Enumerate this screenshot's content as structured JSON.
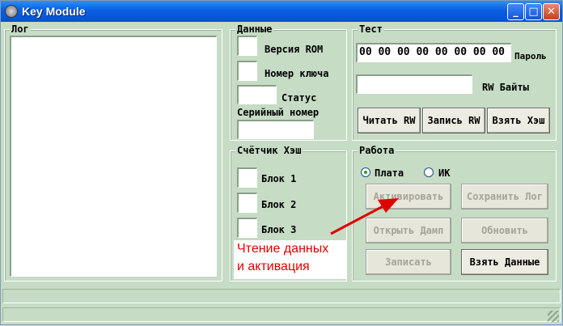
{
  "window": {
    "title": "Key Module",
    "controls": {
      "minimize": "_",
      "maximize": "□",
      "close": "✕"
    }
  },
  "log": {
    "label": "Лог"
  },
  "data_group": {
    "label": "Данные",
    "rom_version_label": "Версия ROM",
    "key_number_label": "Номер ключа",
    "status_label": "Статус",
    "serial_label": "Серийный номер"
  },
  "test_group": {
    "label": "Тест",
    "password_value": "00 00 00 00 00 00 00 00",
    "password_label": "Пароль",
    "rw_bytes_label": "RW Байты",
    "read_rw": "Читать RW",
    "write_rw": "Запись RW",
    "take_hash": "Взять Хэш"
  },
  "hash_counter": {
    "label": "Счётчик Хэш",
    "block1": "Блок 1",
    "block2": "Блок 2",
    "block3": "Блок 3"
  },
  "work_group": {
    "label": "Работа",
    "radio_board": "Плата",
    "radio_ik": "ИК",
    "selected": "Плата",
    "activate": "Активировать",
    "save_log": "Сохранить Лог",
    "open_dump": "Открыть Дамп",
    "update": "Обновить",
    "write": "Записать",
    "take_data": "Взять Данные"
  },
  "annotation": {
    "line1": "Чтение данных",
    "line2": "и активация",
    "color": "#e00000"
  }
}
